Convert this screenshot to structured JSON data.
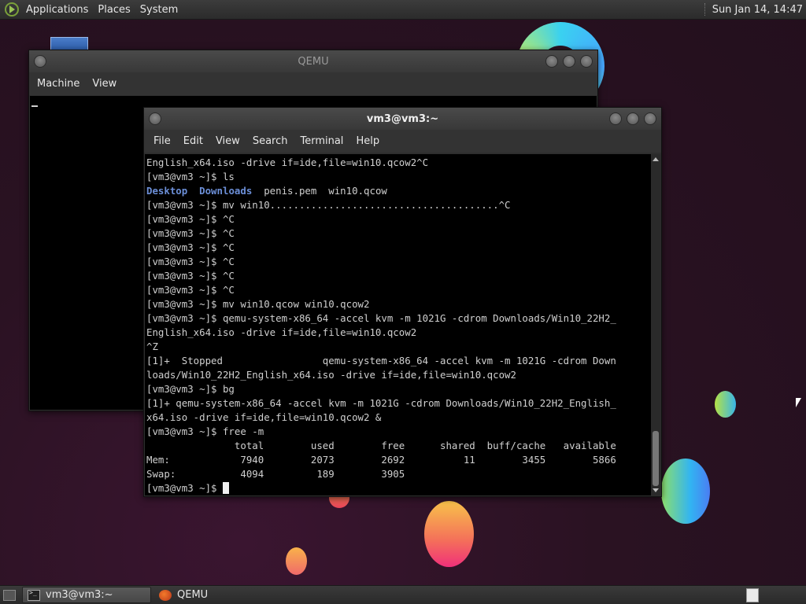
{
  "top_panel": {
    "menus": [
      "Applications",
      "Places",
      "System"
    ],
    "clock": "Sun Jan 14, 14:47"
  },
  "qemu_window": {
    "title": "QEMU",
    "menus": [
      "Machine",
      "View"
    ]
  },
  "terminal_window": {
    "title": "vm3@vm3:~",
    "menus": [
      "File",
      "Edit",
      "View",
      "Search",
      "Terminal",
      "Help"
    ],
    "lines": [
      "English_x64.iso -drive if=ide,file=win10.qcow2^C",
      "[vm3@vm3 ~]$ ls",
      "__LS__",
      "[vm3@vm3 ~]$ mv win10.......................................^C",
      "[vm3@vm3 ~]$ ^C",
      "[vm3@vm3 ~]$ ^C",
      "[vm3@vm3 ~]$ ^C",
      "[vm3@vm3 ~]$ ^C",
      "[vm3@vm3 ~]$ ^C",
      "[vm3@vm3 ~]$ ^C",
      "[vm3@vm3 ~]$ mv win10.qcow win10.qcow2",
      "[vm3@vm3 ~]$ qemu-system-x86_64 -accel kvm -m 1021G -cdrom Downloads/Win10_22H2_",
      "English_x64.iso -drive if=ide,file=win10.qcow2",
      "^Z",
      "[1]+  Stopped                 qemu-system-x86_64 -accel kvm -m 1021G -cdrom Down",
      "loads/Win10_22H2_English_x64.iso -drive if=ide,file=win10.qcow2",
      "[vm3@vm3 ~]$ bg",
      "[1]+ qemu-system-x86_64 -accel kvm -m 1021G -cdrom Downloads/Win10_22H2_English_",
      "x64.iso -drive if=ide,file=win10.qcow2 &",
      "[vm3@vm3 ~]$ free -m",
      "               total        used        free      shared  buff/cache   available",
      "Mem:            7940        2073        2692          11        3455        5866",
      "Swap:           4094         189        3905"
    ],
    "ls_output": {
      "dirs": [
        "Desktop",
        "Downloads"
      ],
      "files": [
        "penis.pem",
        "win10.qcow"
      ]
    },
    "prompt": "[vm3@vm3 ~]$ "
  },
  "taskbar": {
    "tasks": [
      {
        "label": "vm3@vm3:~",
        "active": true
      },
      {
        "label": "QEMU",
        "active": false
      }
    ]
  }
}
